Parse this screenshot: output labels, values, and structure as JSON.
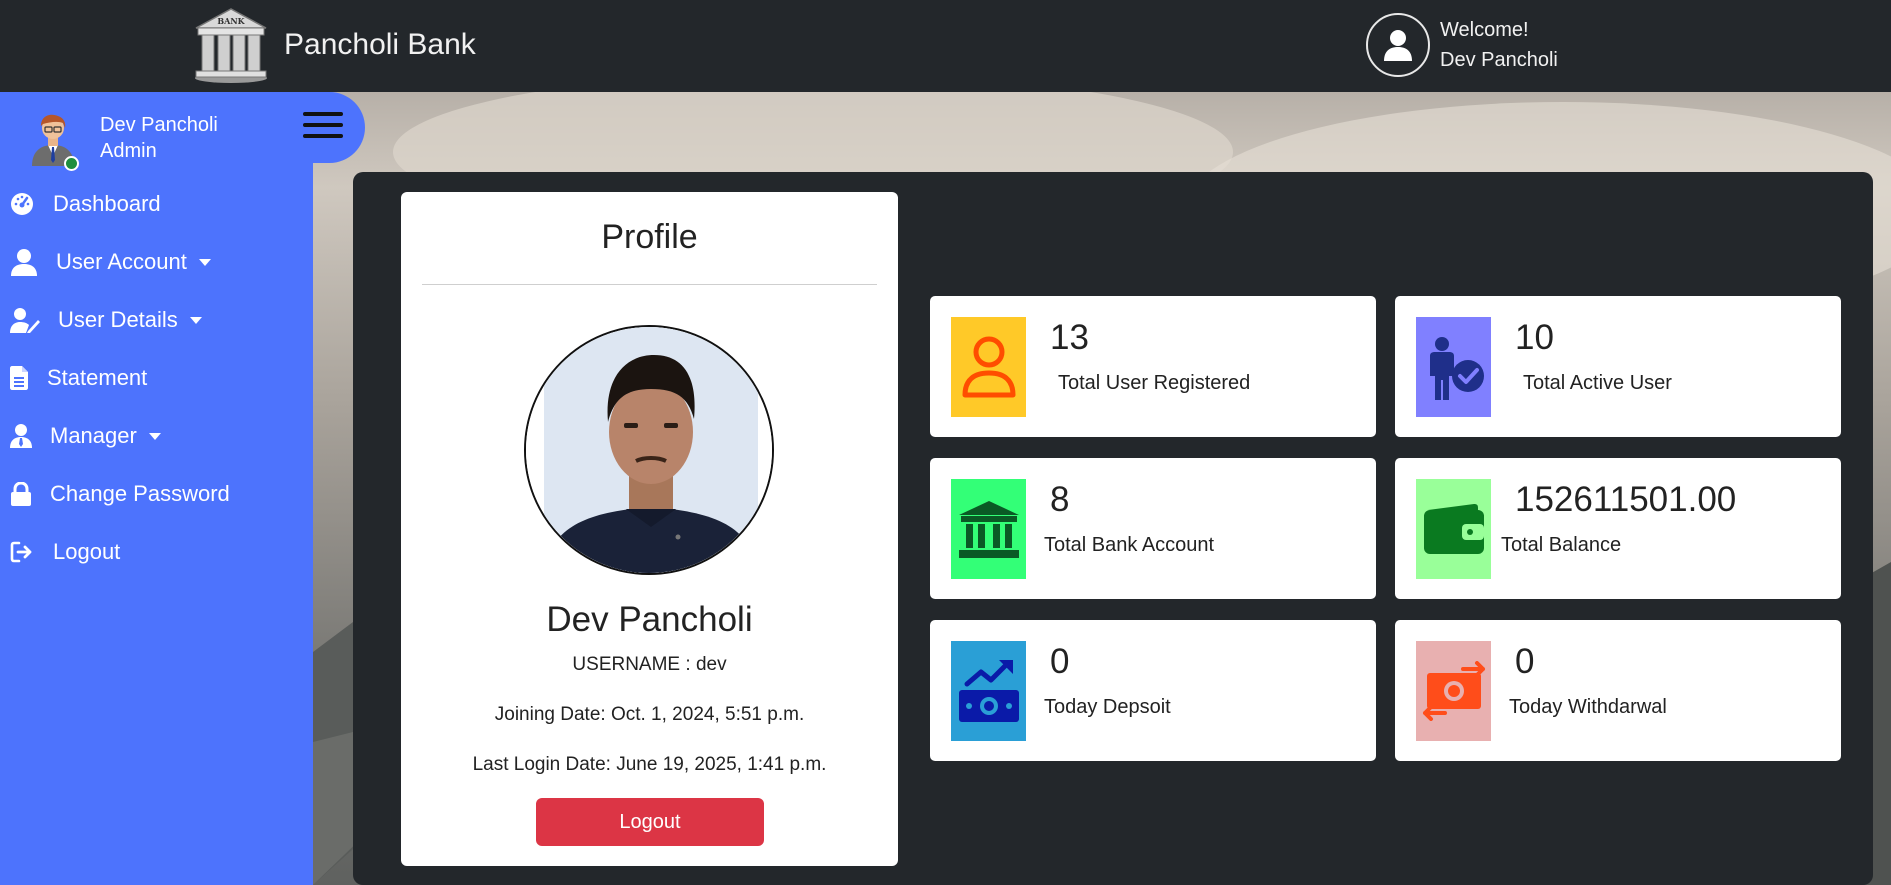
{
  "brand": {
    "name": "Pancholi Bank",
    "logo_text": "BANK"
  },
  "welcome": {
    "greeting": "Welcome!",
    "user": "Dev Pancholi"
  },
  "sidebar": {
    "user_name": "Dev Pancholi",
    "role": "Admin",
    "items": [
      {
        "label": "Dashboard",
        "icon": "gauge-icon"
      },
      {
        "label": "User Account",
        "icon": "user-icon",
        "dropdown": true
      },
      {
        "label": "User Details",
        "icon": "user-edit-icon",
        "dropdown": true
      },
      {
        "label": "Statement",
        "icon": "file-icon"
      },
      {
        "label": "Manager",
        "icon": "user-tie-icon",
        "dropdown": true
      },
      {
        "label": "Change Password",
        "icon": "lock-icon"
      },
      {
        "label": "Logout",
        "icon": "sign-out-icon"
      }
    ]
  },
  "profile": {
    "title": "Profile",
    "name": "Dev Pancholi",
    "username": "USERNAME : dev",
    "joining": "Joining Date: Oct. 1, 2024, 5:51 p.m.",
    "last_login": "Last Login Date: June 19, 2025, 1:41 p.m.",
    "logout_label": "Logout"
  },
  "stats": [
    {
      "value": "13",
      "label": "Total User Registered",
      "color": "#ffc928",
      "icon": "user-outline-icon"
    },
    {
      "value": "10",
      "label": "Total Active User",
      "color": "#8080ff",
      "icon": "user-check-icon"
    },
    {
      "value": "8",
      "label": "Total Bank Account",
      "color": "#33ff77",
      "icon": "bank-icon"
    },
    {
      "value": "152611501.00",
      "label": "Total Balance",
      "color": "#99ff99",
      "icon": "wallet-icon"
    },
    {
      "value": "0",
      "label": "Today Depsoit",
      "color": "#2a9fd6",
      "icon": "deposit-icon"
    },
    {
      "value": "0",
      "label": "Today Withdarwal",
      "color": "#e8b0b0",
      "icon": "withdraw-icon"
    }
  ]
}
